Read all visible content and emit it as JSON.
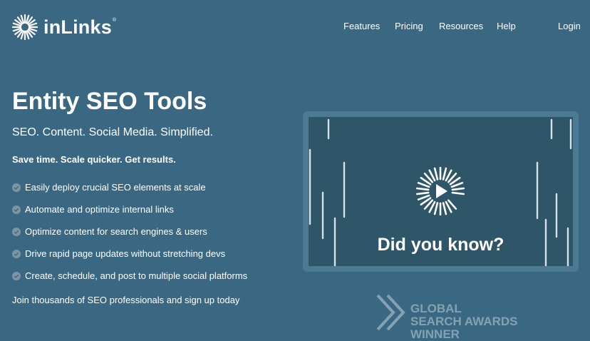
{
  "brand": {
    "name": "inLinks",
    "reg": "®",
    "logo_icon": "sunburst-icon"
  },
  "nav": {
    "features": "Features",
    "pricing": "Pricing",
    "resources": "Resources",
    "help": "Help",
    "login": "Login"
  },
  "hero": {
    "title": "Entity SEO Tools",
    "subtitle": "SEO. Content. Social Media. Simplified.",
    "tagline": "Save time. Scale quicker. Get results.",
    "features": [
      "Easily deploy crucial SEO elements at scale",
      "Automate and optimize internal links",
      "Optimize content for search engines & users",
      "Drive rapid page updates without stretching devs",
      "Create, schedule, and post to multiple social platforms"
    ],
    "join": "Join thousands of SEO professionals and sign up today"
  },
  "video": {
    "caption": "Did you know?"
  },
  "award": {
    "line1": "GLOBAL",
    "line2": "SEARCH AWARDS",
    "line3": "WINNER"
  },
  "colors": {
    "background": "#3a6882",
    "video_bg": "#2e5668",
    "video_frame": "#4c7a93",
    "check_bg": "#7d95a3"
  }
}
